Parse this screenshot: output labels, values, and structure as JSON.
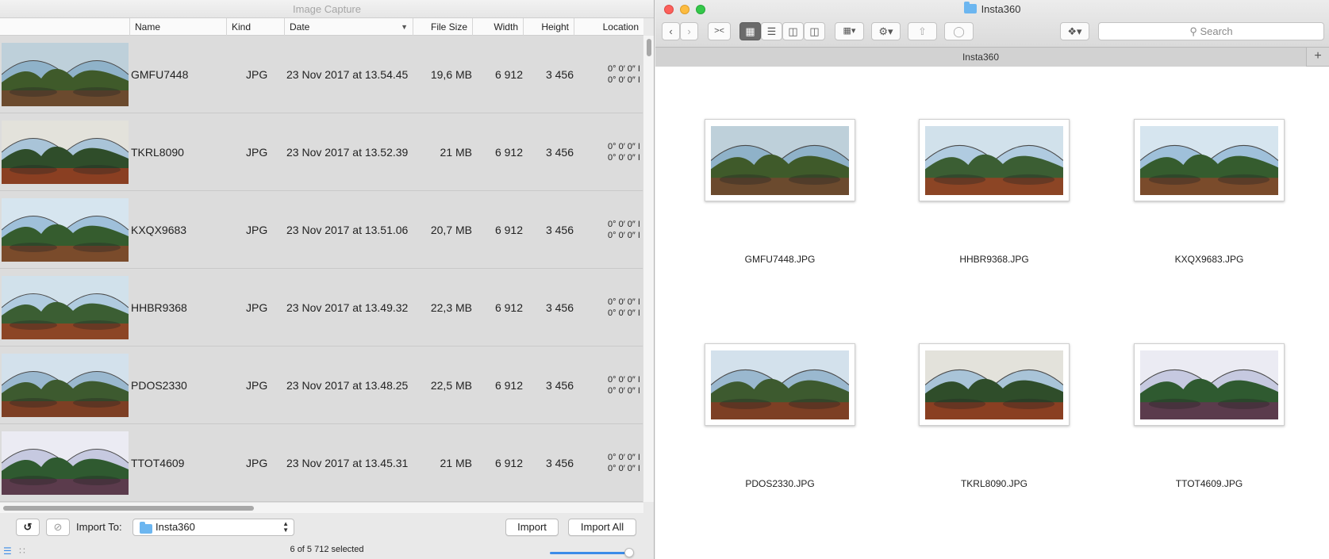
{
  "image_capture": {
    "title": "Image Capture",
    "columns": {
      "name": "Name",
      "kind": "Kind",
      "date": "Date",
      "size": "File Size",
      "width": "Width",
      "height": "Height",
      "location": "Location"
    },
    "rows": [
      {
        "name": "GMFU7448",
        "kind": "JPG",
        "date": "23 Nov 2017 at 13.54.45",
        "size": "19,6 MB",
        "width": "6 912",
        "height": "3 456",
        "loc1": "0° 0′ 0″ I",
        "loc2": "0° 0′ 0″ I"
      },
      {
        "name": "TKRL8090",
        "kind": "JPG",
        "date": "23 Nov 2017 at 13.52.39",
        "size": "21 MB",
        "width": "6 912",
        "height": "3 456",
        "loc1": "0° 0′ 0″ I",
        "loc2": "0° 0′ 0″ I"
      },
      {
        "name": "KXQX9683",
        "kind": "JPG",
        "date": "23 Nov 2017 at 13.51.06",
        "size": "20,7 MB",
        "width": "6 912",
        "height": "3 456",
        "loc1": "0° 0′ 0″ I",
        "loc2": "0° 0′ 0″ I"
      },
      {
        "name": "HHBR9368",
        "kind": "JPG",
        "date": "23 Nov 2017 at 13.49.32",
        "size": "22,3 MB",
        "width": "6 912",
        "height": "3 456",
        "loc1": "0° 0′ 0″ I",
        "loc2": "0° 0′ 0″ I"
      },
      {
        "name": "PDOS2330",
        "kind": "JPG",
        "date": "23 Nov 2017 at 13.48.25",
        "size": "22,5 MB",
        "width": "6 912",
        "height": "3 456",
        "loc1": "0° 0′ 0″ I",
        "loc2": "0° 0′ 0″ I"
      },
      {
        "name": "TTOT4609",
        "kind": "JPG",
        "date": "23 Nov 2017 at 13.45.31",
        "size": "21 MB",
        "width": "6 912",
        "height": "3 456",
        "loc1": "0° 0′ 0″ I",
        "loc2": "0° 0′ 0″ I"
      }
    ],
    "import_to_label": "Import To:",
    "import_to_value": "Insta360",
    "import_button": "Import",
    "import_all_button": "Import All",
    "status": "6 of 5 712 selected",
    "rotate_icon": "rotate-left-icon",
    "delete_icon": "no-entry-icon"
  },
  "finder": {
    "title": "Insta360",
    "tab_label": "Insta360",
    "search_placeholder": "Search",
    "items": [
      {
        "name": "GMFU7448.JPG"
      },
      {
        "name": "HHBR9368.JPG"
      },
      {
        "name": "KXQX9683.JPG"
      },
      {
        "name": "PDOS2330.JPG"
      },
      {
        "name": "TKRL8090.JPG"
      },
      {
        "name": "TTOT4609.JPG"
      }
    ],
    "traffic_colors": {
      "close": "#fc605b",
      "minimize": "#fdbc40",
      "zoom": "#34c84a"
    }
  }
}
